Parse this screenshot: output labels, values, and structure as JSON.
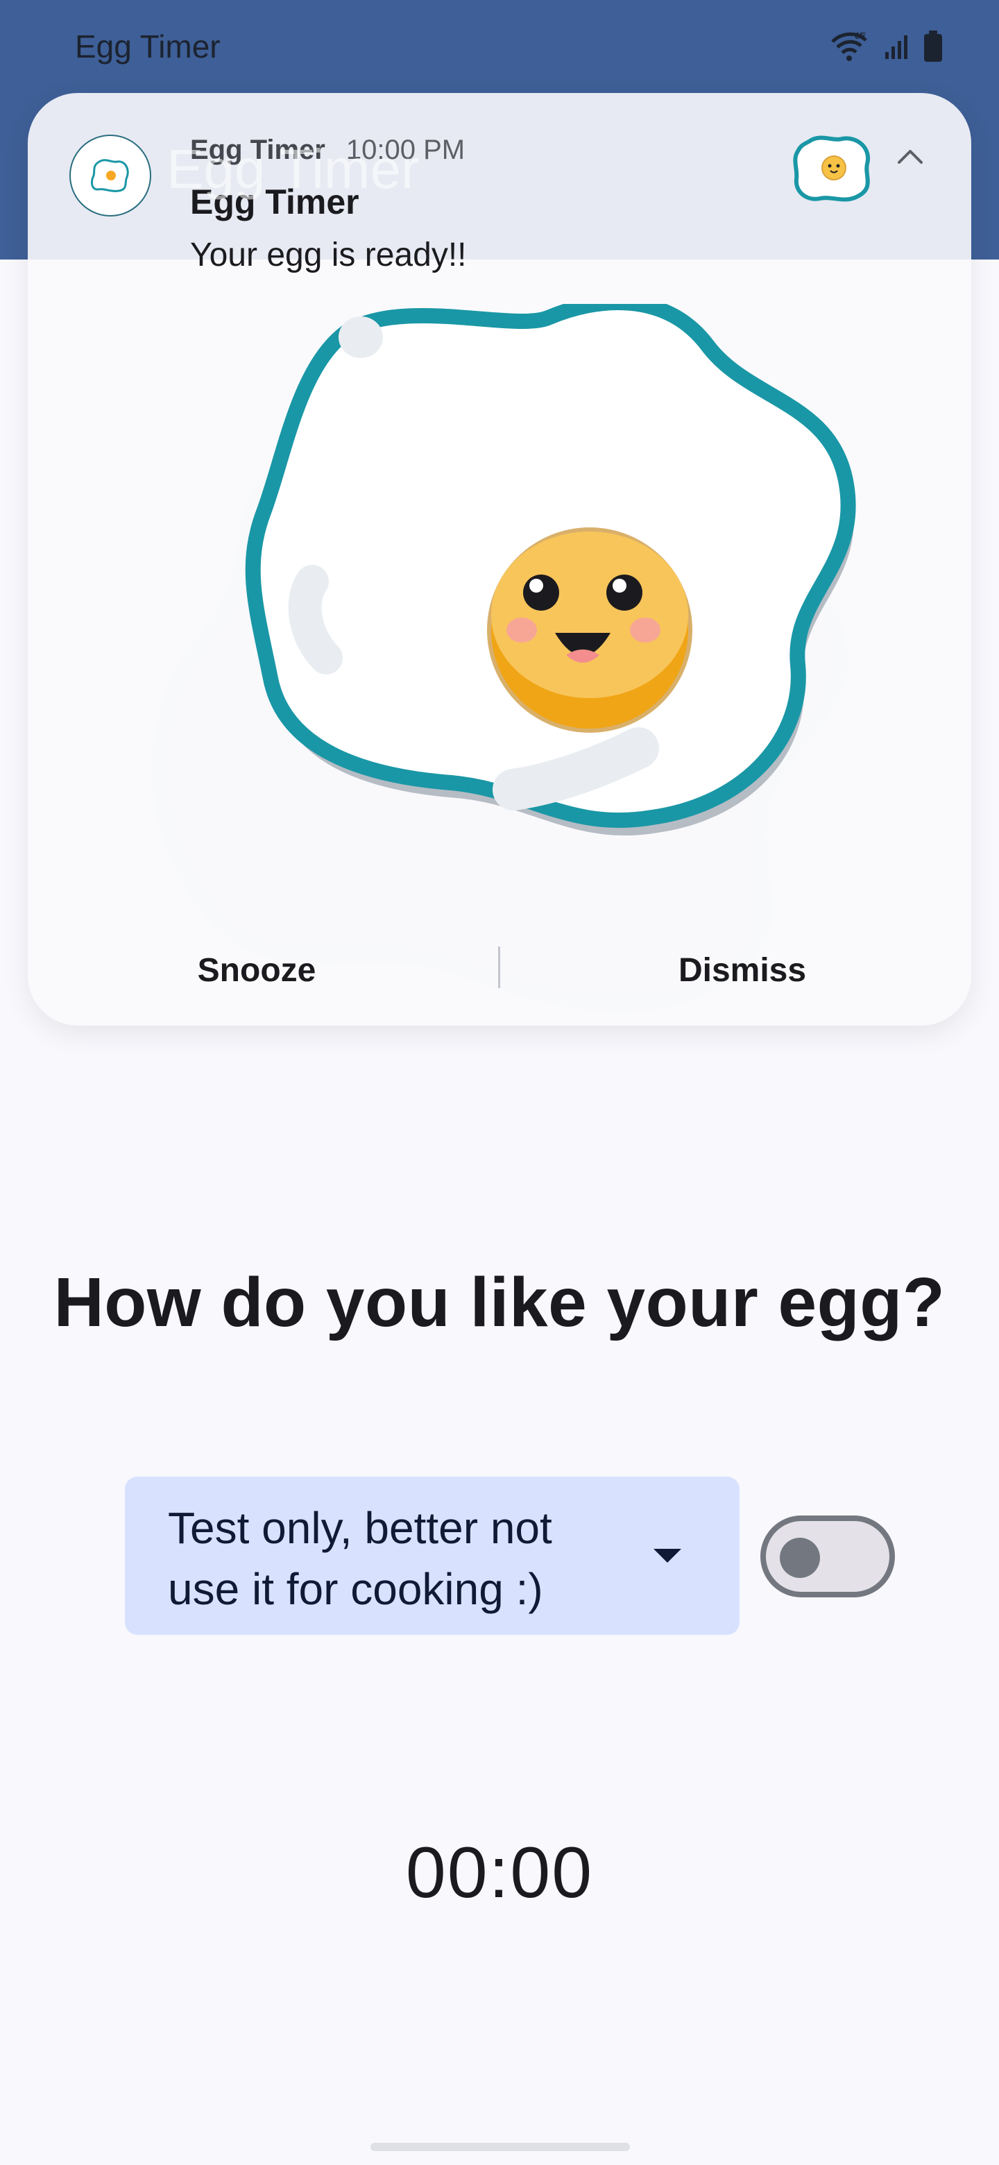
{
  "status_bar": {
    "title": "Egg Timer",
    "icons": [
      "wifi-6e-icon",
      "signal-icon",
      "battery-icon"
    ],
    "wifi_label": "6E"
  },
  "app_bar": {
    "title": "Egg Timer",
    "color": "#3e5f97"
  },
  "notification": {
    "app_name": "Egg Timer",
    "time": "10:00 PM",
    "title": "Egg Timer",
    "text": "Your egg is ready!!",
    "actions": {
      "snooze": "Snooze",
      "dismiss": "Dismiss"
    },
    "expand_icon": "chevron-up-icon"
  },
  "main": {
    "headline": "How do you like your egg?",
    "dropdown": {
      "selected": "Test only, better not\nuse it for cooking :)",
      "icon": "dropdown-arrow-icon"
    },
    "toggle": {
      "on": false
    },
    "timer": "00:00"
  },
  "colors": {
    "egg_outline": "#1a97a6",
    "yolk": "#f7c245",
    "dropdown_bg": "#d8e2ff"
  }
}
